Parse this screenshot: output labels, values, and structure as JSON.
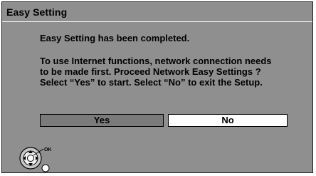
{
  "dialog": {
    "title": "Easy Setting",
    "heading": "Easy Setting has been completed.",
    "message_lines": [
      "To use Internet functions, network connection needs",
      "to be made first. Proceed Network Easy Settings ?",
      "Select “Yes” to start. Select “No” to exit the Setup."
    ]
  },
  "buttons": {
    "yes_label": "Yes",
    "no_label": "No"
  },
  "remote_hint": {
    "icon": "remote-dpad-icon",
    "ok_label": "OK"
  },
  "colors": {
    "background": "#8f8f8f",
    "selected_button": "#7b7b7b",
    "unselected_button": "#ffffff",
    "text": "#000000"
  }
}
